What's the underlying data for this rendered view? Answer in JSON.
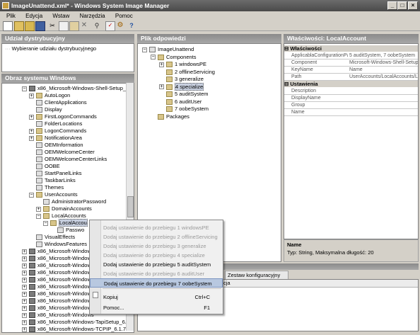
{
  "window": {
    "title": "ImageUnattend.xml* - Windows System Image Manager"
  },
  "menubar": [
    "Plik",
    "Edycja",
    "Wstaw",
    "Narzędzia",
    "Pomoc"
  ],
  "distribution": {
    "title": "Udział dystrybucyjny",
    "item": "Wybieranie udziału dystrybucyjnego"
  },
  "windows_image": {
    "title": "Obraz systemu Windows",
    "rows": [
      {
        "indent": 0,
        "exp": "-",
        "icon": "pkg",
        "label": "x86_Microsoft-Windows-Shell-Setup_6.1."
      },
      {
        "indent": 1,
        "exp": "+",
        "icon": "folder",
        "label": "AutoLogon"
      },
      {
        "indent": 1,
        "exp": "",
        "icon": "doc",
        "label": "ClientApplications"
      },
      {
        "indent": 1,
        "exp": "",
        "icon": "doc",
        "label": "Display"
      },
      {
        "indent": 1,
        "exp": "+",
        "icon": "folder",
        "label": "FirstLogonCommands"
      },
      {
        "indent": 1,
        "exp": "",
        "icon": "doc",
        "label": "FolderLocations"
      },
      {
        "indent": 1,
        "exp": "+",
        "icon": "folder",
        "label": "LogonCommands"
      },
      {
        "indent": 1,
        "exp": "+",
        "icon": "folder",
        "label": "NotificationArea"
      },
      {
        "indent": 1,
        "exp": "",
        "icon": "doc",
        "label": "OEMInformation"
      },
      {
        "indent": 1,
        "exp": "",
        "icon": "doc",
        "label": "OEMWelcomeCenter"
      },
      {
        "indent": 1,
        "exp": "",
        "icon": "doc",
        "label": "OEMWelcomeCenterLinks"
      },
      {
        "indent": 1,
        "exp": "",
        "icon": "doc",
        "label": "OOBE"
      },
      {
        "indent": 1,
        "exp": "",
        "icon": "doc",
        "label": "StartPanelLinks"
      },
      {
        "indent": 1,
        "exp": "",
        "icon": "doc",
        "label": "TaskbarLinks"
      },
      {
        "indent": 1,
        "exp": "",
        "icon": "doc",
        "label": "Themes"
      },
      {
        "indent": 1,
        "exp": "-",
        "icon": "folder",
        "label": "UserAccounts"
      },
      {
        "indent": 2,
        "exp": "",
        "icon": "doc",
        "label": "AdministratorPassword"
      },
      {
        "indent": 2,
        "exp": "+",
        "icon": "folder",
        "label": "DomainAccounts"
      },
      {
        "indent": 2,
        "exp": "-",
        "icon": "folder",
        "label": "LocalAccounts"
      },
      {
        "indent": 3,
        "exp": "-",
        "icon": "folder",
        "label": "LocalAccou"
      },
      {
        "indent": 4,
        "exp": "",
        "icon": "doc",
        "label": "Passwo"
      },
      {
        "indent": 1,
        "exp": "",
        "icon": "doc",
        "label": "VisualEffects"
      },
      {
        "indent": 1,
        "exp": "",
        "icon": "doc",
        "label": "WindowsFeatures"
      },
      {
        "indent": 0,
        "exp": "+",
        "icon": "pkg",
        "label": "x86_Microsoft-Windows"
      },
      {
        "indent": 0,
        "exp": "+",
        "icon": "pkg",
        "label": "x86_Microsoft-Windows"
      },
      {
        "indent": 0,
        "exp": "+",
        "icon": "pkg",
        "label": "x86_Microsoft-Windows"
      },
      {
        "indent": 0,
        "exp": "+",
        "icon": "pkg",
        "label": "x86_Microsoft-Windows"
      },
      {
        "indent": 0,
        "exp": "+",
        "icon": "pkg",
        "label": "x86_Microsoft-Windows"
      },
      {
        "indent": 0,
        "exp": "+",
        "icon": "pkg",
        "label": "x86_Microsoft-Windows"
      },
      {
        "indent": 0,
        "exp": "+",
        "icon": "pkg",
        "label": "x86_Microsoft-Windows"
      },
      {
        "indent": 0,
        "exp": "+",
        "icon": "pkg",
        "label": "x86_Microsoft-Windows"
      },
      {
        "indent": 0,
        "exp": "+",
        "icon": "pkg",
        "label": "x86_Microsoft-Windows"
      },
      {
        "indent": 0,
        "exp": "+",
        "icon": "pkg",
        "label": "x86_Microsoft-Windows"
      },
      {
        "indent": 0,
        "exp": "+",
        "icon": "pkg",
        "label": "x86_Microsoft-Windows-TapiSetup_6.1.7"
      },
      {
        "indent": 0,
        "exp": "+",
        "icon": "pkg",
        "label": "x86_Microsoft-Windows-TCPIP_6.1.7601"
      }
    ]
  },
  "answer_file": {
    "title": "Plik odpowiedzi",
    "rows": [
      {
        "indent": 0,
        "exp": "-",
        "icon": "doc",
        "label": "ImageUnattend"
      },
      {
        "indent": 1,
        "exp": "-",
        "icon": "folder",
        "label": "Components"
      },
      {
        "indent": 2,
        "exp": "+",
        "icon": "folder",
        "label": "1 windowsPE"
      },
      {
        "indent": 2,
        "exp": "",
        "icon": "folder",
        "label": "2 offlineServicing"
      },
      {
        "indent": 2,
        "exp": "",
        "icon": "folder",
        "label": "3 generalize"
      },
      {
        "indent": 2,
        "exp": "+",
        "icon": "folder",
        "label": "4 specialize"
      },
      {
        "indent": 2,
        "exp": "",
        "icon": "folder",
        "label": "5 auditSystem"
      },
      {
        "indent": 2,
        "exp": "",
        "icon": "folder",
        "label": "6 auditUser"
      },
      {
        "indent": 2,
        "exp": "",
        "icon": "folder",
        "label": "7 oobeSystem"
      },
      {
        "indent": 1,
        "exp": "",
        "icon": "folder",
        "label": "Packages"
      }
    ]
  },
  "properties": {
    "title": "Właściwości: LocalAccount",
    "cat1": "Właściwości",
    "rows1": [
      {
        "k": "ApplicablaConfigurationPa",
        "v": "5 auditSystem, 7 oobeSystem"
      },
      {
        "k": "Component",
        "v": "Microsoft-Windows-Shell-Setup"
      },
      {
        "k": "KeyName",
        "v": "Name"
      },
      {
        "k": "Path",
        "v": "UserAccounts/LocalAccounts/L"
      }
    ],
    "cat2": "Ustawienia",
    "rows2": [
      {
        "k": "Description",
        "v": ""
      },
      {
        "k": "DisplayName",
        "v": ""
      },
      {
        "k": "Group",
        "v": ""
      },
      {
        "k": "Name",
        "v": ""
      }
    ],
    "desc_title": "Name",
    "desc_text": "Typ: String, Maksymalna długość: 20"
  },
  "bottom_tabs": {
    "tab": "Zestaw konfiguracyjny (0)",
    "col": "cja"
  },
  "context_menu": [
    {
      "label": "Dodaj ustawienie do przebiegu 1 windowsPE",
      "state": "dis",
      "sc": ""
    },
    {
      "label": "Dodaj ustawienie do przebiegu 2 offlineServicing",
      "state": "dis",
      "sc": ""
    },
    {
      "label": "Dodaj ustawienie do przebiegu 3 generalize",
      "state": "dis",
      "sc": ""
    },
    {
      "label": "Dodaj ustawienie do przebiegu 4 specialize",
      "state": "dis",
      "sc": ""
    },
    {
      "label": "Dodaj ustawienie do przebiegu 5 auditSystem",
      "state": "",
      "sc": ""
    },
    {
      "label": "Dodaj ustawienie do przebiegu 6 auditUser",
      "state": "dis",
      "sc": ""
    },
    {
      "label": "Dodaj ustawienie do przebiegu 7 oobeSystem",
      "state": "hl",
      "sc": ""
    },
    {
      "label": "Kopiuj",
      "state": "",
      "sc": "Ctrl+C"
    },
    {
      "label": "Pomoc...",
      "state": "",
      "sc": "F1"
    }
  ]
}
